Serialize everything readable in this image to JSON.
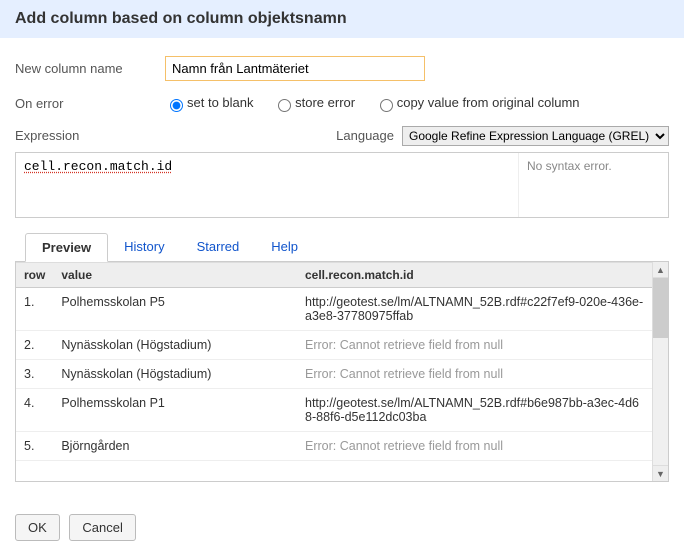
{
  "header": {
    "title": "Add column based on column objektsnamn"
  },
  "form": {
    "newColLabel": "New column name",
    "newColValue": "Namn från Lantmäteriet",
    "onErrorLabel": "On error",
    "onError": {
      "blank": "set to blank",
      "store": "store error",
      "copy": "copy value from original column"
    },
    "exprLabel": "Expression",
    "langLabel": "Language",
    "langValue": "Google Refine Expression Language (GREL)",
    "exprValue": "cell.recon.match.id",
    "exprStatus": "No syntax error."
  },
  "tabs": {
    "preview": "Preview",
    "history": "History",
    "starred": "Starred",
    "help": "Help"
  },
  "previewTable": {
    "headers": {
      "row": "row",
      "value": "value",
      "result": "cell.recon.match.id"
    },
    "rows": [
      {
        "n": "1.",
        "value": "Polhemsskolan P5",
        "result": "http://geotest.se/lm/ALTNAMN_52B.rdf#c22f7ef9-020e-436e-a3e8-37780975ffab",
        "err": false
      },
      {
        "n": "2.",
        "value": "Nynässkolan (Högstadium)",
        "result": "Error: Cannot retrieve field from null",
        "err": true
      },
      {
        "n": "3.",
        "value": "Nynässkolan (Högstadium)",
        "result": "Error: Cannot retrieve field from null",
        "err": true
      },
      {
        "n": "4.",
        "value": "Polhemsskolan P1",
        "result": "http://geotest.se/lm/ALTNAMN_52B.rdf#b6e987bb-a3ec-4d68-88f6-d5e112dc03ba",
        "err": false
      },
      {
        "n": "5.",
        "value": "Björngården",
        "result": "Error: Cannot retrieve field from null",
        "err": true
      }
    ]
  },
  "footer": {
    "ok": "OK",
    "cancel": "Cancel"
  }
}
